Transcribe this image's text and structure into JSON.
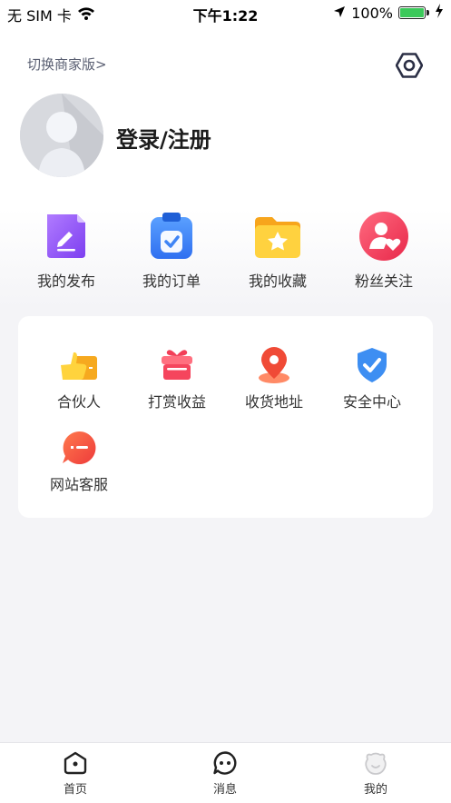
{
  "status_bar": {
    "carrier": "无 SIM 卡",
    "time": "下午1:22",
    "battery": "100%",
    "battery_level": 1.0,
    "icons": [
      "wifi-icon",
      "location-arrow-icon",
      "battery-icon",
      "charging-icon"
    ]
  },
  "header": {
    "switch_link": "切换商家版>",
    "settings_icon": "hexagon-gear-icon"
  },
  "profile": {
    "login_label": "登录/注册",
    "avatar_icon": "default-avatar-icon"
  },
  "quick_actions": [
    {
      "label": "我的发布",
      "icon": "edit-note-icon",
      "color": "#8b54f0"
    },
    {
      "label": "我的订单",
      "icon": "clipboard-check-icon",
      "color": "#3f84f5"
    },
    {
      "label": "我的收藏",
      "icon": "star-folder-icon",
      "color": "#ffc22f"
    },
    {
      "label": "粉丝关注",
      "icon": "fan-heart-icon",
      "color": "#f04561"
    }
  ],
  "services": [
    {
      "label": "合伙人",
      "icon": "partner-card-icon",
      "color": "#f7b82a"
    },
    {
      "label": "打赏收益",
      "icon": "gift-icon",
      "color": "#f5455d"
    },
    {
      "label": "收货地址",
      "icon": "map-pin-icon",
      "color": "#f3603a"
    },
    {
      "label": "安全中心",
      "icon": "shield-check-icon",
      "color": "#3d8ef2"
    },
    {
      "label": "网站客服",
      "icon": "chat-bubble-icon",
      "color": "#f14b45"
    }
  ],
  "tabbar": {
    "items": [
      {
        "label": "首页",
        "icon": "home-icon"
      },
      {
        "label": "消息",
        "icon": "message-icon"
      },
      {
        "label": "我的",
        "icon": "mine-face-icon"
      }
    ]
  }
}
